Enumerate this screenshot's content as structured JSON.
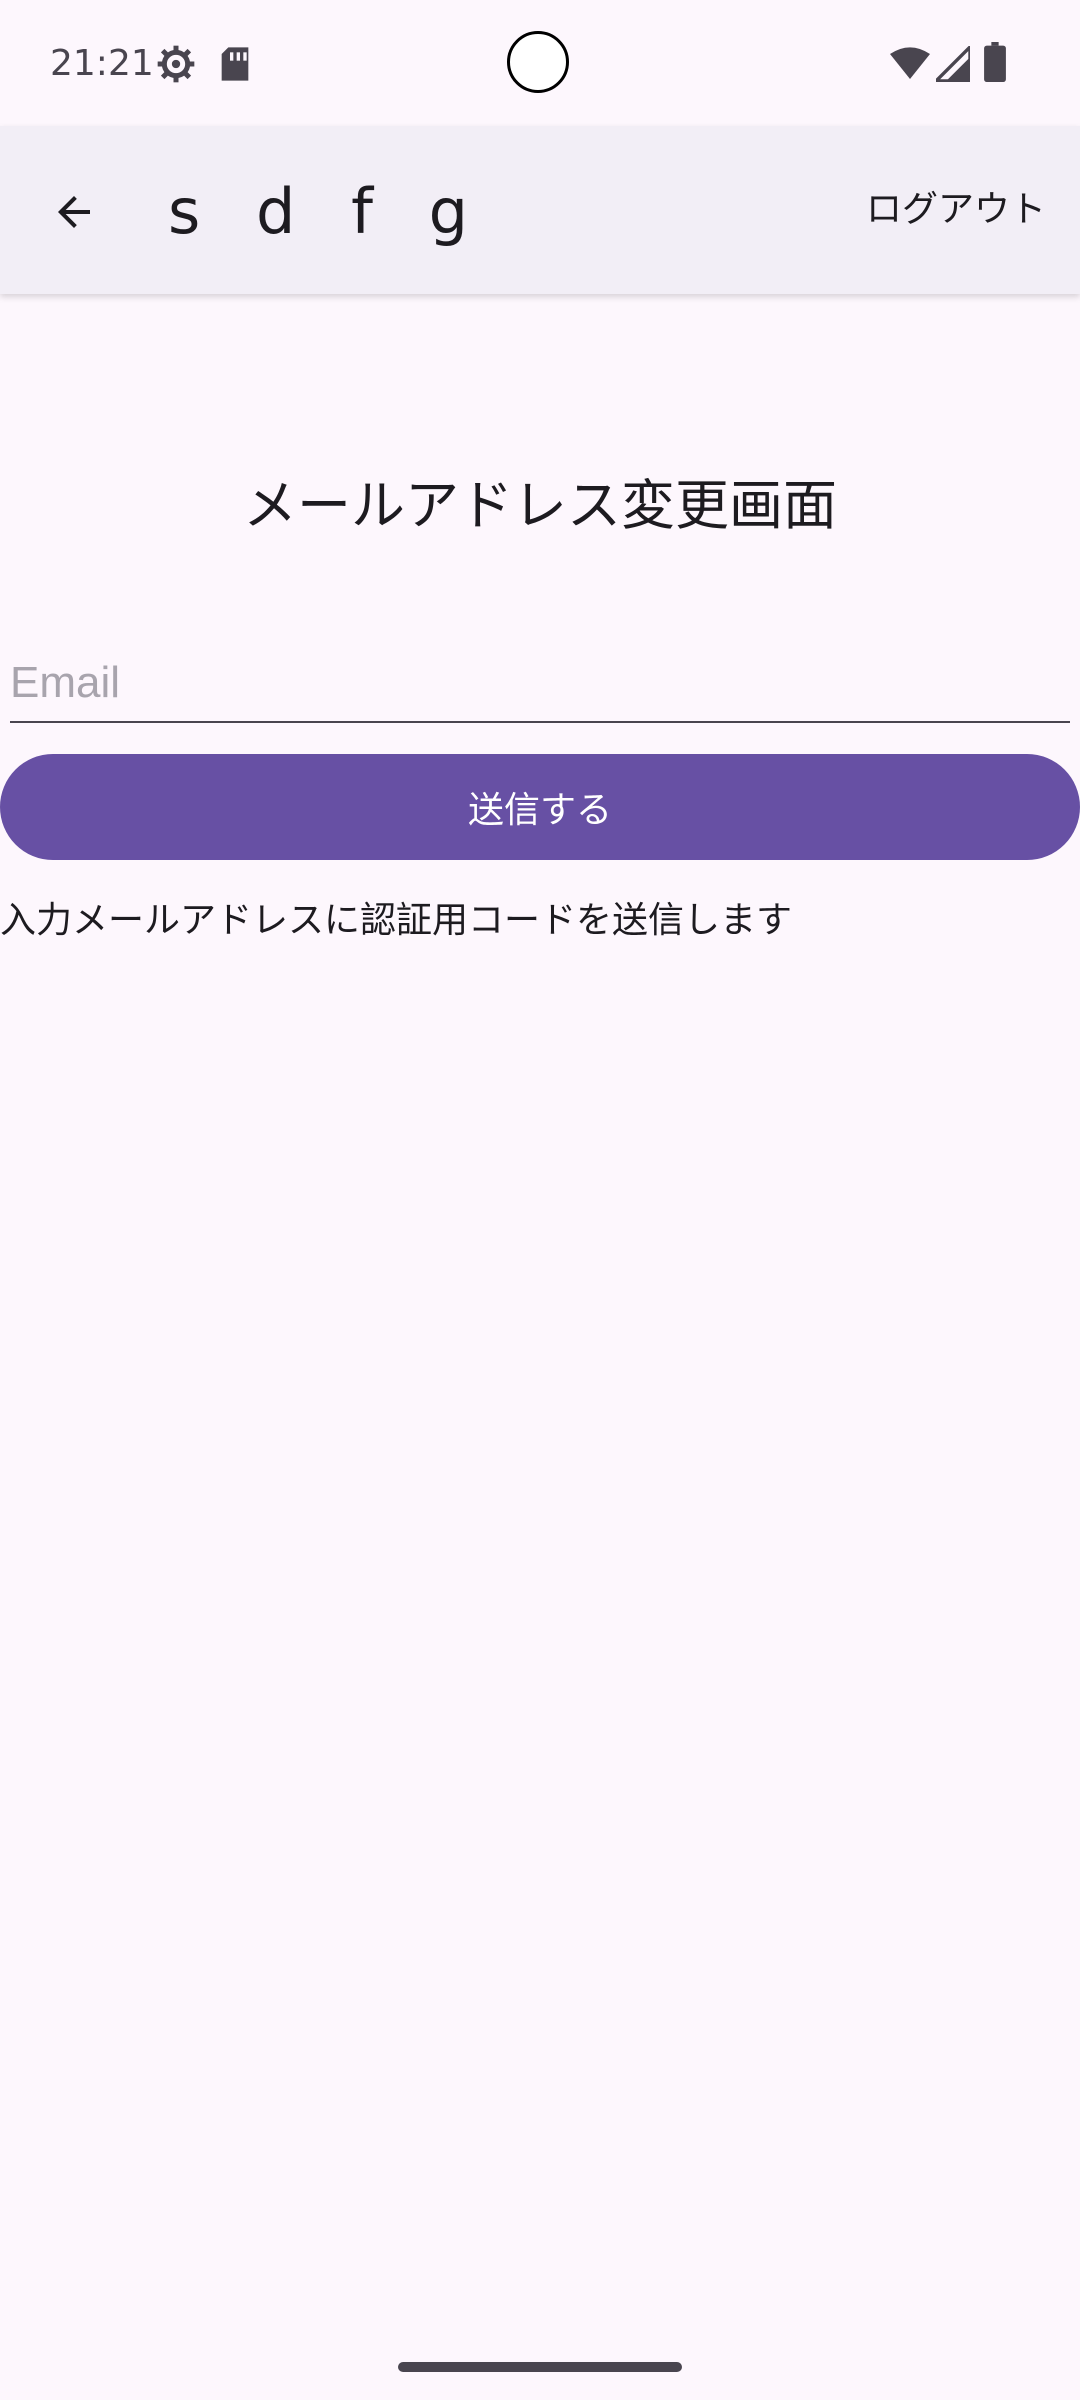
{
  "status_bar": {
    "time": "21:21",
    "icons": [
      "settings-icon",
      "sd-card-icon",
      "wifi-icon",
      "signal-icon",
      "battery-icon"
    ]
  },
  "app_bar": {
    "title": "s d f g",
    "back_icon": "arrow-back-icon",
    "logout_label": "ログアウト"
  },
  "main": {
    "heading": "メールアドレス変更画面",
    "email_placeholder": "Email",
    "email_value": "",
    "submit_label": "送信する",
    "hint": "入力メールアドレスに認証用コードを送信します"
  },
  "colors": {
    "background": "#fdf7fd",
    "app_bar": "#f2eef6",
    "primary": "#6750a4",
    "text": "#1d1b20",
    "placeholder": "#a8a4ad"
  }
}
